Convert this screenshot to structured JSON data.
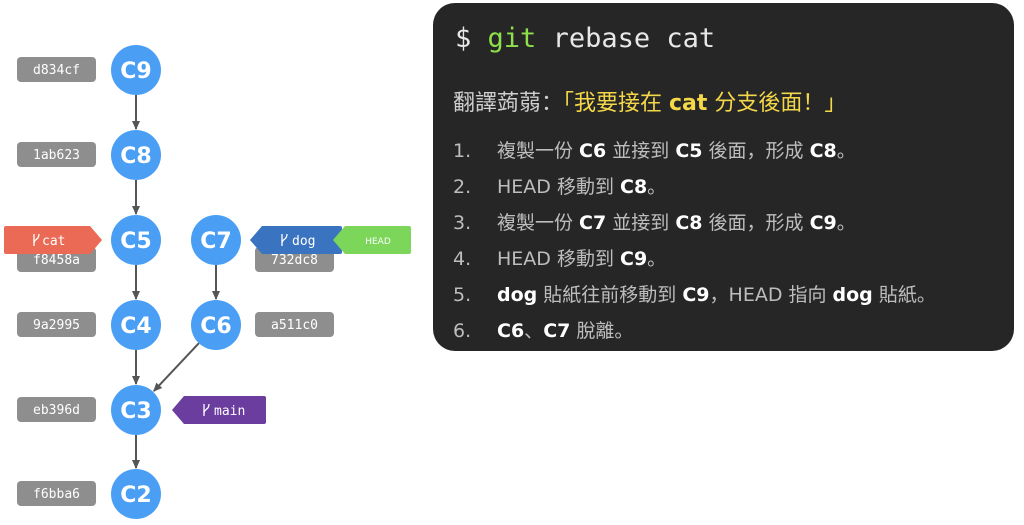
{
  "colors": {
    "commit": "#4a9ff5",
    "hash_box": "#8e8e8e",
    "branch_cat": "#ea6a56",
    "branch_dog": "#3a74c0",
    "branch_main": "#6a3d9f",
    "head": "#7bd65a",
    "panel_bg": "#262626",
    "git_keyword": "#8ee04a",
    "quote": "#f5d849"
  },
  "commits": [
    {
      "id": "C9",
      "hash": "d834cf"
    },
    {
      "id": "C8",
      "hash": "1ab623"
    },
    {
      "id": "C5",
      "hash": "f8458a"
    },
    {
      "id": "C7",
      "hash": "732dc8"
    },
    {
      "id": "C4",
      "hash": "9a2995"
    },
    {
      "id": "C6",
      "hash": "a511c0"
    },
    {
      "id": "C3",
      "hash": "eb396d"
    },
    {
      "id": "C2",
      "hash": "f6bba6"
    }
  ],
  "edges": [
    {
      "from": "C9",
      "to": "C8"
    },
    {
      "from": "C8",
      "to": "C5"
    },
    {
      "from": "C5",
      "to": "C4"
    },
    {
      "from": "C4",
      "to": "C3"
    },
    {
      "from": "C3",
      "to": "C2"
    },
    {
      "from": "C7",
      "to": "C6"
    },
    {
      "from": "C6",
      "to": "C3"
    }
  ],
  "branches": [
    {
      "name": "cat",
      "target": "C5",
      "icon": "branch-icon"
    },
    {
      "name": "dog",
      "target": "C7",
      "icon": "branch-icon"
    },
    {
      "name": "main",
      "target": "C3",
      "icon": "branch-icon"
    }
  ],
  "head_label": "HEAD",
  "command": {
    "prompt": "$",
    "tool": "git",
    "args": "rebase cat"
  },
  "translation": {
    "prefix": "翻譯蒟蒻：",
    "open": "「我要接在 ",
    "branch": "cat",
    "close": " 分支後面！」"
  },
  "steps": [
    [
      "1.",
      "複製一份 ",
      {
        "b": "C6"
      },
      " 並接到 ",
      {
        "b": "C5"
      },
      " 後面，形成 ",
      {
        "b": "C8"
      },
      "。"
    ],
    [
      "2.",
      "HEAD 移動到 ",
      {
        "b": "C8"
      },
      "。"
    ],
    [
      "3.",
      "複製一份 ",
      {
        "b": "C7"
      },
      " 並接到 ",
      {
        "b": "C8"
      },
      " 後面，形成 ",
      {
        "b": "C9"
      },
      "。"
    ],
    [
      "4.",
      "HEAD 移動到 ",
      {
        "b": "C9"
      },
      "。"
    ],
    [
      "5.",
      {
        "b": "dog"
      },
      " 貼紙往前移動到 ",
      {
        "b": "C9"
      },
      "，HEAD 指向 ",
      {
        "b": "dog"
      },
      " 貼紙。"
    ],
    [
      "6.",
      {
        "b": "C6"
      },
      "、",
      {
        "b": "C7"
      },
      " 脫離。"
    ]
  ]
}
